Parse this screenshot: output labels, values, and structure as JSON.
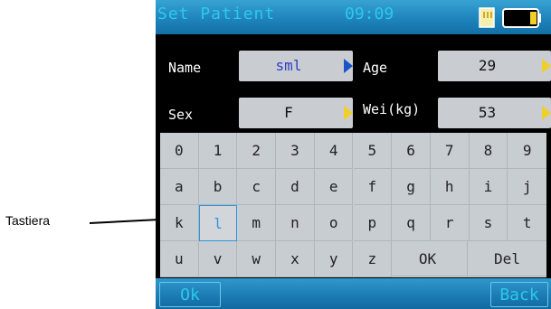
{
  "callout": {
    "label": "Tastiera"
  },
  "header": {
    "title": "Set Patient",
    "time": "09:09",
    "sd_icon": "sd-card-icon",
    "battery_icon": "battery-icon"
  },
  "fields": {
    "name": {
      "label": "Name",
      "value": "sml"
    },
    "age": {
      "label": "Age",
      "value": "29"
    },
    "sex": {
      "label": "Sex",
      "value": "F"
    },
    "weight": {
      "label": "Wei(kg)",
      "value": "53"
    }
  },
  "keyboard": {
    "rows": [
      [
        "0",
        "1",
        "2",
        "3",
        "4",
        "5",
        "6",
        "7",
        "8",
        "9"
      ],
      [
        "a",
        "b",
        "c",
        "d",
        "e",
        "f",
        "g",
        "h",
        "i",
        "j"
      ],
      [
        "k",
        "l",
        "m",
        "n",
        "o",
        "p",
        "q",
        "r",
        "s",
        "t"
      ],
      [
        "u",
        "v",
        "w",
        "x",
        "y",
        "z"
      ]
    ],
    "ok_label": "OK",
    "del_label": "Del",
    "selected_key": "l"
  },
  "footer": {
    "ok_label": "Ok",
    "back_label": "Back"
  },
  "colors": {
    "titlebar": "#1f84bc",
    "title_text": "#2cc9ec",
    "field_bg": "#c9cdd2",
    "arrow_yellow": "#f0cf2a",
    "arrow_blue": "#1b53c8",
    "selected_key": "#2f95e0"
  }
}
